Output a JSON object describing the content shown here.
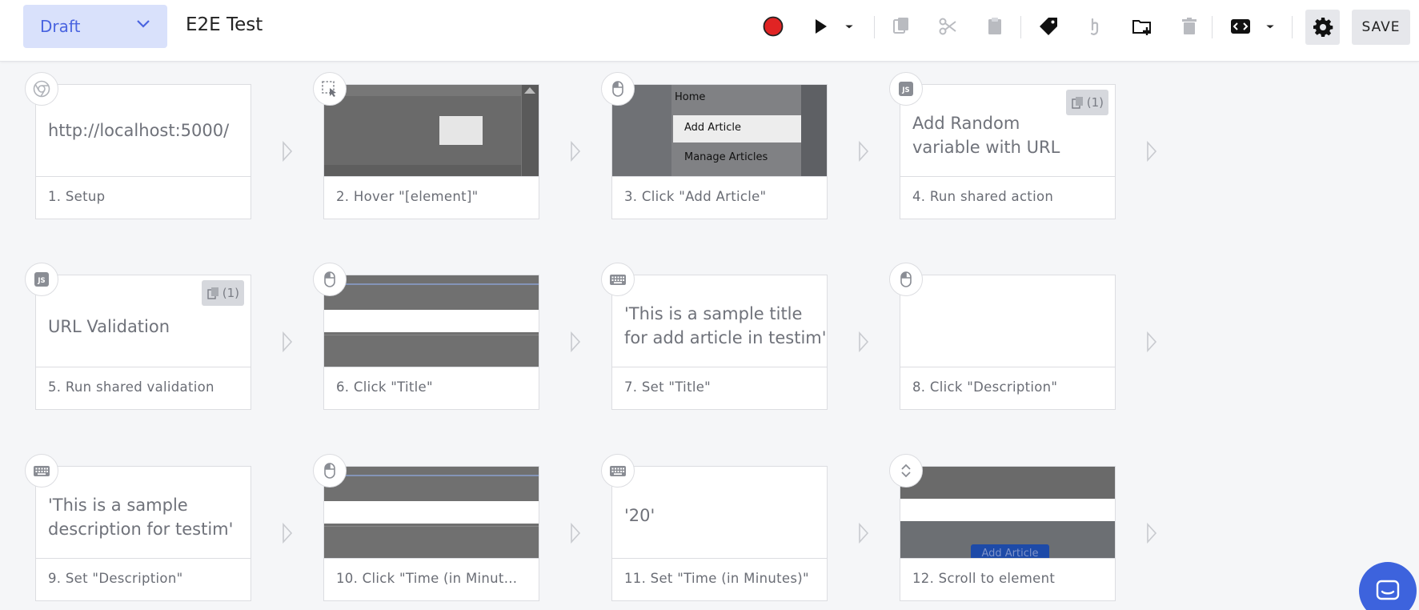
{
  "header": {
    "status": "Draft",
    "test_name": "E2E Test",
    "save_label": "SAVE"
  },
  "toolbar_icons": [
    "record-icon",
    "play-icon",
    "play-options-icon",
    "copy-icon",
    "cut-icon",
    "paste-icon",
    "label-icon",
    "pointer-icon",
    "new-folder-icon",
    "delete-icon",
    "code-icon",
    "code-options-icon",
    "settings-icon"
  ],
  "steps": [
    {
      "label": "1. Setup",
      "text": "http://localhost:5000/",
      "type": "chrome-icon"
    },
    {
      "label": "2. Hover \"[element]\"",
      "type": "hover-select-icon"
    },
    {
      "label": "3. Click \"Add Article\"",
      "type": "mouse-icon",
      "menu": [
        "Home",
        "Add Article",
        "Manage Articles"
      ]
    },
    {
      "label": "4. Run shared action",
      "text_lines": [
        "Add Random",
        "variable with URL"
      ],
      "type": "js-icon",
      "shared": "(1)"
    },
    {
      "label": "5. Run shared validation",
      "text": "URL Validation",
      "type": "js-icon",
      "shared": "(1)"
    },
    {
      "label": "6. Click \"Title\"",
      "type": "mouse-icon"
    },
    {
      "label": "7. Set \"Title\"",
      "text_lines": [
        "'This is a sample title",
        "for add article in testim'"
      ],
      "type": "keyboard-icon"
    },
    {
      "label": "8. Click \"Description\"",
      "type": "mouse-icon"
    },
    {
      "label": "9. Set \"Description\"",
      "text_lines": [
        "'This is a sample",
        "description for testim'"
      ],
      "type": "keyboard-icon"
    },
    {
      "label": "10. Click \"Time (in Minut...",
      "type": "mouse-icon"
    },
    {
      "label": "11. Set \"Time (in Minutes)\"",
      "text": "'20'",
      "type": "keyboard-icon"
    },
    {
      "label": "12. Scroll to element",
      "type": "scroll-icon",
      "thumb_button": "Add Article"
    }
  ],
  "colors": {
    "accent": "#4a64e0",
    "status_bg": "#d9e1fb",
    "record": "#e02424",
    "chat": "#3d63dd"
  }
}
